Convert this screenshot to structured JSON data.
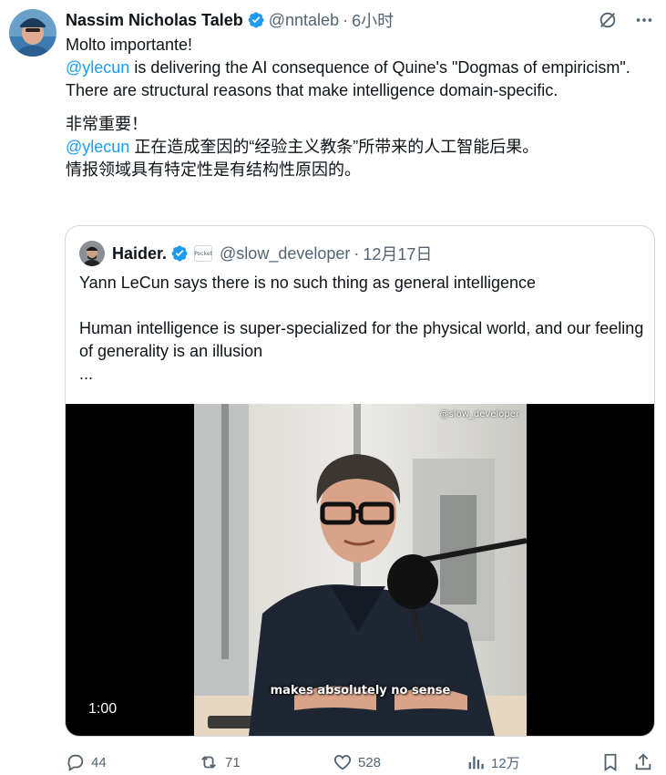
{
  "tweet": {
    "author": {
      "name": "Nassim Nicholas Taleb",
      "handle": "@nntaleb",
      "time": "6小时"
    },
    "body": {
      "line1": "Molto importante!",
      "mention1": "@ylecun",
      "line2_rest": " is delivering the AI consequence of Quine's \"Dogmas of empiricism\".",
      "line3": "There are structural reasons that make intelligence domain-specific.",
      "line4": "非常重要！",
      "mention2": "@ylecun",
      "line5_rest": " 正在造成奎因的“经验主义教条”所带来的人工智能后果。",
      "line6": "情报领域具有特定性是有结构性原因的。"
    },
    "separator": "·"
  },
  "quote": {
    "author": {
      "name": "Haider.",
      "badge": "Pocket",
      "handle": "@slow_developer",
      "date": "12月17日"
    },
    "line1": "Yann LeCun says there is no such thing as general intelligence",
    "line2": "Human intelligence is super-specialized for the physical world, and our feeling of generality is an illusion",
    "ellipsis": "...",
    "video": {
      "watermark": "@slow_developer",
      "caption": "makes absolutely no sense",
      "duration": "1:00"
    }
  },
  "actions": {
    "replies": "44",
    "reposts": "71",
    "likes": "528",
    "views": "12万"
  },
  "colors": {
    "accent": "#1d9bf0",
    "muted": "#536471",
    "text": "#0f1419",
    "border": "#cfd9de"
  }
}
